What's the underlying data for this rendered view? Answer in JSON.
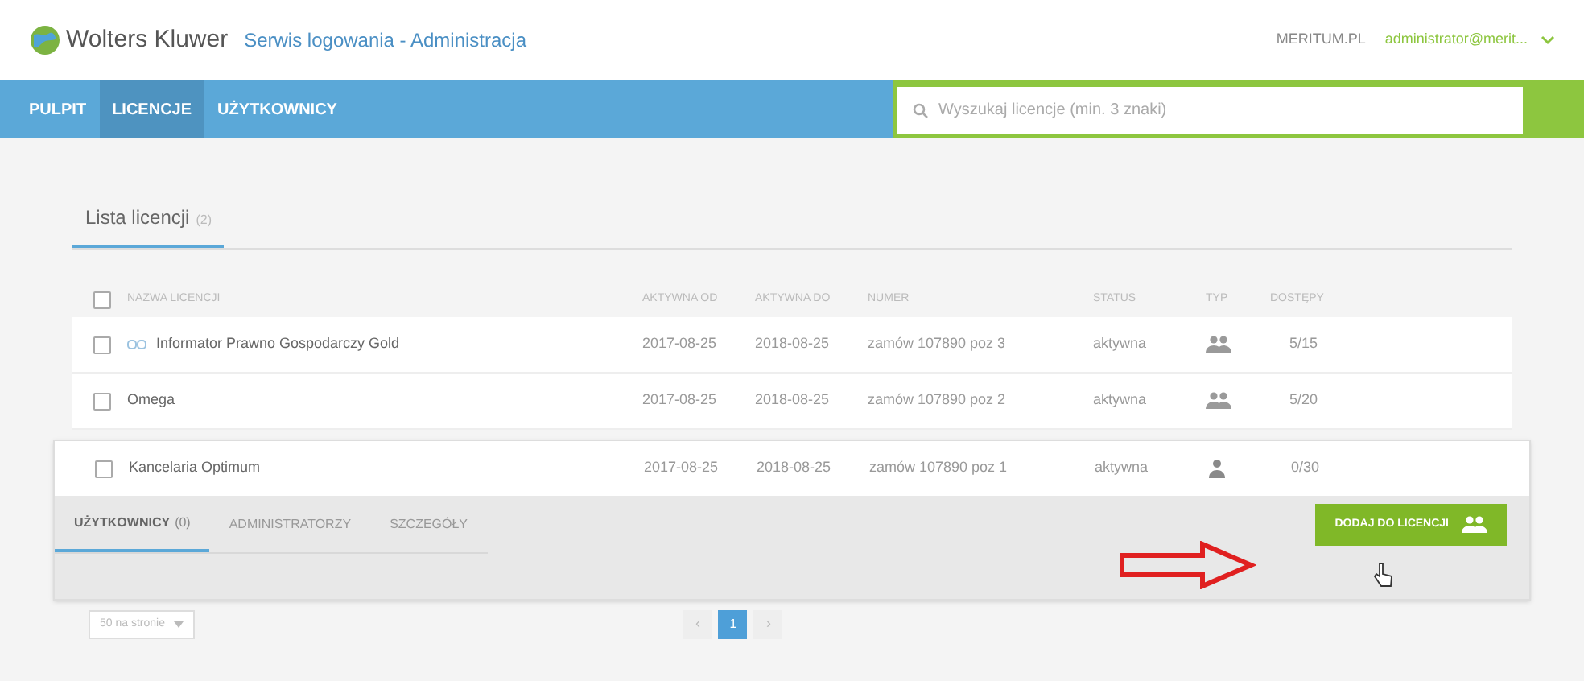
{
  "header": {
    "brand": "Wolters Kluwer",
    "app_title": "Serwis logowania - Administracja",
    "site_link": "MERITUM.PL",
    "user": "administrator@merit..."
  },
  "nav": {
    "tabs": [
      {
        "label": "PULPIT",
        "selected": false
      },
      {
        "label": "LICENCJE",
        "selected": true
      },
      {
        "label": "UŻYTKOWNICY",
        "selected": false
      }
    ],
    "search": {
      "placeholder": "Wyszukaj licencje (min. 3 znaki)"
    }
  },
  "list_tab": {
    "label": "Lista licencji",
    "count": "(2)"
  },
  "table": {
    "select_all": {
      "checked": false
    },
    "columns": [
      "NAZWA LICENCJI",
      "AKTYWNA OD",
      "AKTYWNA DO",
      "NUMER",
      "STATUS",
      "TYP",
      "DOSTĘPY"
    ],
    "rows": [
      {
        "checked": false,
        "linked": true,
        "name": "Informator Prawno Gospodarczy Gold",
        "from": "2017-08-25",
        "to": "2018-08-25",
        "number": "zamów 107890 poz 3",
        "status": "aktywna",
        "kind": "group",
        "access": "5/15",
        "expanded": false
      },
      {
        "checked": false,
        "linked": false,
        "name": "Omega",
        "from": "2017-08-25",
        "to": "2018-08-25",
        "number": "zamów 107890 poz 2",
        "status": "aktywna",
        "kind": "group",
        "access": "5/20",
        "expanded": false
      },
      {
        "checked": false,
        "linked": false,
        "name": "Kancelaria Optimum",
        "from": "2017-08-25",
        "to": "2018-08-25",
        "number": "zamów 107890 poz 1",
        "status": "aktywna",
        "kind": "person",
        "access": "0/30",
        "expanded": true
      }
    ]
  },
  "detail": {
    "tabs": [
      {
        "label": "UŻYTKOWNICY",
        "count": "(0)",
        "selected": true
      },
      {
        "label": "ADMINISTRATORZY",
        "selected": false
      },
      {
        "label": "SZCZEGÓŁY",
        "selected": false
      }
    ],
    "add_button": "DODAJ DO LICENCJI"
  },
  "pagination": {
    "per_page": "50 na stronie",
    "prev": "‹",
    "pages": [
      {
        "label": "1",
        "selected": true
      }
    ],
    "next": "›"
  }
}
